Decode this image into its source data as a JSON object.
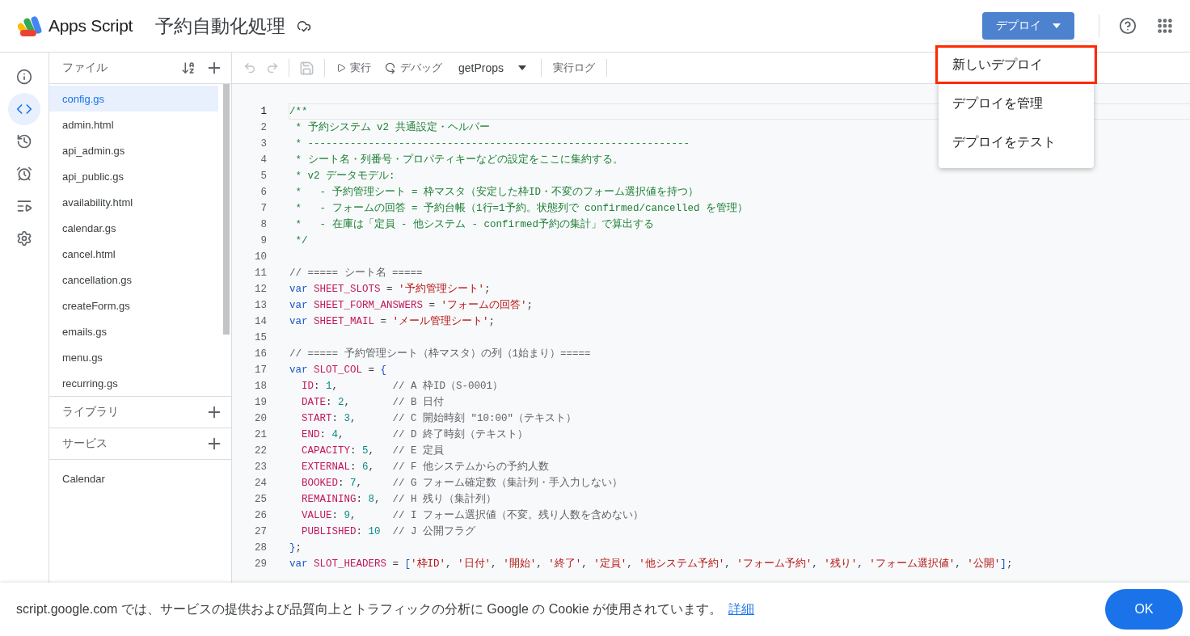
{
  "header": {
    "product": "Apps Script",
    "project_title": "予約自動化処理",
    "deploy_button": "デプロイ"
  },
  "deploy_menu": {
    "items": [
      {
        "label": "新しいデプロイ",
        "highlighted": true
      },
      {
        "label": "デプロイを管理",
        "highlighted": false
      },
      {
        "label": "デプロイをテスト",
        "highlighted": false
      }
    ]
  },
  "nav_rail": [
    {
      "kind": "info",
      "selected": false
    },
    {
      "kind": "editor",
      "selected": true
    },
    {
      "kind": "history",
      "selected": false
    },
    {
      "kind": "triggers",
      "selected": false
    },
    {
      "kind": "executions",
      "selected": false
    },
    {
      "kind": "settings",
      "selected": false
    }
  ],
  "files": {
    "heading": "ファイル",
    "items": [
      {
        "name": "config.gs",
        "selected": true
      },
      {
        "name": "admin.html",
        "selected": false
      },
      {
        "name": "api_admin.gs",
        "selected": false
      },
      {
        "name": "api_public.gs",
        "selected": false
      },
      {
        "name": "availability.html",
        "selected": false
      },
      {
        "name": "calendar.gs",
        "selected": false
      },
      {
        "name": "cancel.html",
        "selected": false
      },
      {
        "name": "cancellation.gs",
        "selected": false
      },
      {
        "name": "createForm.gs",
        "selected": false
      },
      {
        "name": "emails.gs",
        "selected": false
      },
      {
        "name": "menu.gs",
        "selected": false
      },
      {
        "name": "recurring.gs",
        "selected": false
      }
    ]
  },
  "libraries": {
    "heading": "ライブラリ"
  },
  "services": {
    "heading": "サービス",
    "items": [
      "Calendar"
    ]
  },
  "toolbar": {
    "run": "実行",
    "debug": "デバッグ",
    "function": "getProps",
    "log": "実行ログ"
  },
  "editor": {
    "lines": [
      {
        "number": "1",
        "current": true,
        "tokens": [
          {
            "kind": "doc",
            "text": "/**"
          }
        ]
      },
      {
        "number": "2",
        "current": false,
        "tokens": [
          {
            "kind": "doc",
            "text": " * 予約システム v2 共通設定・ヘルパー"
          }
        ]
      },
      {
        "number": "3",
        "current": false,
        "tokens": [
          {
            "kind": "doc",
            "text": " * ---------------------------------------------------------------"
          }
        ]
      },
      {
        "number": "4",
        "current": false,
        "tokens": [
          {
            "kind": "doc",
            "text": " * シート名・列番号・プロパティキーなどの設定をここに集約する。"
          }
        ]
      },
      {
        "number": "5",
        "current": false,
        "tokens": [
          {
            "kind": "doc",
            "text": " * v2 データモデル:"
          }
        ]
      },
      {
        "number": "6",
        "current": false,
        "tokens": [
          {
            "kind": "doc",
            "text": " *   - 予約管理シート = 枠マスタ（安定した枠ID・不変のフォーム選択値を持つ）"
          }
        ]
      },
      {
        "number": "7",
        "current": false,
        "tokens": [
          {
            "kind": "doc",
            "text": " *   - フォームの回答 = 予約台帳（1行=1予約。状態列で confirmed/cancelled を管理）"
          }
        ]
      },
      {
        "number": "8",
        "current": false,
        "tokens": [
          {
            "kind": "doc",
            "text": " *   - 在庫は「定員 - 他システム - confirmed予約の集計」で算出する"
          }
        ]
      },
      {
        "number": "9",
        "current": false,
        "tokens": [
          {
            "kind": "doc",
            "text": " */"
          }
        ]
      },
      {
        "number": "10",
        "current": false
      },
      {
        "number": "11",
        "current": false,
        "tokens": [
          {
            "kind": "comment",
            "text": "// ===== シート名 ====="
          }
        ]
      },
      {
        "number": "12",
        "current": false,
        "tokens": [
          {
            "kind": "keyword",
            "text": "var "
          },
          {
            "kind": "name",
            "text": "SHEET_SLOTS"
          },
          {
            "kind": "plain",
            "text": " = "
          },
          {
            "kind": "string",
            "text": "'予約管理シート'"
          },
          {
            "kind": "plain",
            "text": ";"
          }
        ]
      },
      {
        "number": "13",
        "current": false,
        "tokens": [
          {
            "kind": "keyword",
            "text": "var "
          },
          {
            "kind": "name",
            "text": "SHEET_FORM_ANSWERS"
          },
          {
            "kind": "plain",
            "text": " = "
          },
          {
            "kind": "string",
            "text": "'フォームの回答'"
          },
          {
            "kind": "plain",
            "text": ";"
          }
        ]
      },
      {
        "number": "14",
        "current": false,
        "tokens": [
          {
            "kind": "keyword",
            "text": "var "
          },
          {
            "kind": "name",
            "text": "SHEET_MAIL"
          },
          {
            "kind": "plain",
            "text": " = "
          },
          {
            "kind": "string",
            "text": "'メール管理シート'"
          },
          {
            "kind": "plain",
            "text": ";"
          }
        ]
      },
      {
        "number": "15",
        "current": false
      },
      {
        "number": "16",
        "current": false,
        "tokens": [
          {
            "kind": "comment",
            "text": "// ===== 予約管理シート（枠マスタ）の列（1始まり）====="
          }
        ]
      },
      {
        "number": "17",
        "current": false,
        "tokens": [
          {
            "kind": "keyword",
            "text": "var "
          },
          {
            "kind": "name",
            "text": "SLOT_COL"
          },
          {
            "kind": "plain",
            "text": " = "
          },
          {
            "kind": "bracket",
            "text": "{"
          }
        ]
      },
      {
        "number": "18",
        "current": false,
        "tokens": [
          {
            "kind": "name",
            "text": "  ID"
          },
          {
            "kind": "plain",
            "text": ": "
          },
          {
            "kind": "number",
            "text": "1"
          },
          {
            "kind": "plain",
            "text": ",         "
          },
          {
            "kind": "comment",
            "text": "// A 枠ID（S-0001）"
          }
        ]
      },
      {
        "number": "19",
        "current": false,
        "tokens": [
          {
            "kind": "name",
            "text": "  DATE"
          },
          {
            "kind": "plain",
            "text": ": "
          },
          {
            "kind": "number",
            "text": "2"
          },
          {
            "kind": "plain",
            "text": ",       "
          },
          {
            "kind": "comment",
            "text": "// B 日付"
          }
        ]
      },
      {
        "number": "20",
        "current": false,
        "tokens": [
          {
            "kind": "name",
            "text": "  START"
          },
          {
            "kind": "plain",
            "text": ": "
          },
          {
            "kind": "number",
            "text": "3"
          },
          {
            "kind": "plain",
            "text": ",      "
          },
          {
            "kind": "comment",
            "text": "// C 開始時刻 \"10:00\"（テキスト）"
          }
        ]
      },
      {
        "number": "21",
        "current": false,
        "tokens": [
          {
            "kind": "name",
            "text": "  END"
          },
          {
            "kind": "plain",
            "text": ": "
          },
          {
            "kind": "number",
            "text": "4"
          },
          {
            "kind": "plain",
            "text": ",        "
          },
          {
            "kind": "comment",
            "text": "// D 終了時刻（テキスト）"
          }
        ]
      },
      {
        "number": "22",
        "current": false,
        "tokens": [
          {
            "kind": "name",
            "text": "  CAPACITY"
          },
          {
            "kind": "plain",
            "text": ": "
          },
          {
            "kind": "number",
            "text": "5"
          },
          {
            "kind": "plain",
            "text": ",   "
          },
          {
            "kind": "comment",
            "text": "// E 定員"
          }
        ]
      },
      {
        "number": "23",
        "current": false,
        "tokens": [
          {
            "kind": "name",
            "text": "  EXTERNAL"
          },
          {
            "kind": "plain",
            "text": ": "
          },
          {
            "kind": "number",
            "text": "6"
          },
          {
            "kind": "plain",
            "text": ",   "
          },
          {
            "kind": "comment",
            "text": "// F 他システムからの予約人数"
          }
        ]
      },
      {
        "number": "24",
        "current": false,
        "tokens": [
          {
            "kind": "name",
            "text": "  BOOKED"
          },
          {
            "kind": "plain",
            "text": ": "
          },
          {
            "kind": "number",
            "text": "7"
          },
          {
            "kind": "plain",
            "text": ",     "
          },
          {
            "kind": "comment",
            "text": "// G フォーム確定数（集計列・手入力しない）"
          }
        ]
      },
      {
        "number": "25",
        "current": false,
        "tokens": [
          {
            "kind": "name",
            "text": "  REMAINING"
          },
          {
            "kind": "plain",
            "text": ": "
          },
          {
            "kind": "number",
            "text": "8"
          },
          {
            "kind": "plain",
            "text": ",  "
          },
          {
            "kind": "comment",
            "text": "// H 残り（集計列）"
          }
        ]
      },
      {
        "number": "26",
        "current": false,
        "tokens": [
          {
            "kind": "name",
            "text": "  VALUE"
          },
          {
            "kind": "plain",
            "text": ": "
          },
          {
            "kind": "number",
            "text": "9"
          },
          {
            "kind": "plain",
            "text": ",      "
          },
          {
            "kind": "comment",
            "text": "// I フォーム選択値（不変。残り人数を含めない）"
          }
        ]
      },
      {
        "number": "27",
        "current": false,
        "tokens": [
          {
            "kind": "name",
            "text": "  PUBLISHED"
          },
          {
            "kind": "plain",
            "text": ": "
          },
          {
            "kind": "number",
            "text": "10"
          },
          {
            "kind": "comment",
            "text": "  // J 公開フラグ"
          }
        ]
      },
      {
        "number": "28",
        "current": false,
        "tokens": [
          {
            "kind": "bracket",
            "text": "}"
          },
          {
            "kind": "plain",
            "text": ";"
          }
        ]
      },
      {
        "number": "29",
        "current": false,
        "tokens": [
          {
            "kind": "keyword",
            "text": "var "
          },
          {
            "kind": "name",
            "text": "SLOT_HEADERS"
          },
          {
            "kind": "plain",
            "text": " = "
          },
          {
            "kind": "bracket",
            "text": "["
          },
          {
            "kind": "string",
            "text": "'枠ID'"
          },
          {
            "kind": "plain",
            "text": ", "
          },
          {
            "kind": "string",
            "text": "'日付'"
          },
          {
            "kind": "plain",
            "text": ", "
          },
          {
            "kind": "string",
            "text": "'開始'"
          },
          {
            "kind": "plain",
            "text": ", "
          },
          {
            "kind": "string",
            "text": "'終了'"
          },
          {
            "kind": "plain",
            "text": ", "
          },
          {
            "kind": "string",
            "text": "'定員'"
          },
          {
            "kind": "plain",
            "text": ", "
          },
          {
            "kind": "string",
            "text": "'他システム予約'"
          },
          {
            "kind": "plain",
            "text": ", "
          },
          {
            "kind": "string",
            "text": "'フォーム予約'"
          },
          {
            "kind": "plain",
            "text": ", "
          },
          {
            "kind": "string",
            "text": "'残り'"
          },
          {
            "kind": "plain",
            "text": ", "
          },
          {
            "kind": "string",
            "text": "'フォーム選択値'"
          },
          {
            "kind": "plain",
            "text": ", "
          },
          {
            "kind": "string",
            "text": "'公開'"
          },
          {
            "kind": "bracket",
            "text": "]"
          },
          {
            "kind": "plain",
            "text": ";"
          }
        ]
      }
    ]
  },
  "cookie_banner": {
    "text": "script.google.com では、サービスの提供および品質向上とトラフィックの分析に Google の Cookie が使用されています。",
    "link": "詳細",
    "button": "OK"
  }
}
